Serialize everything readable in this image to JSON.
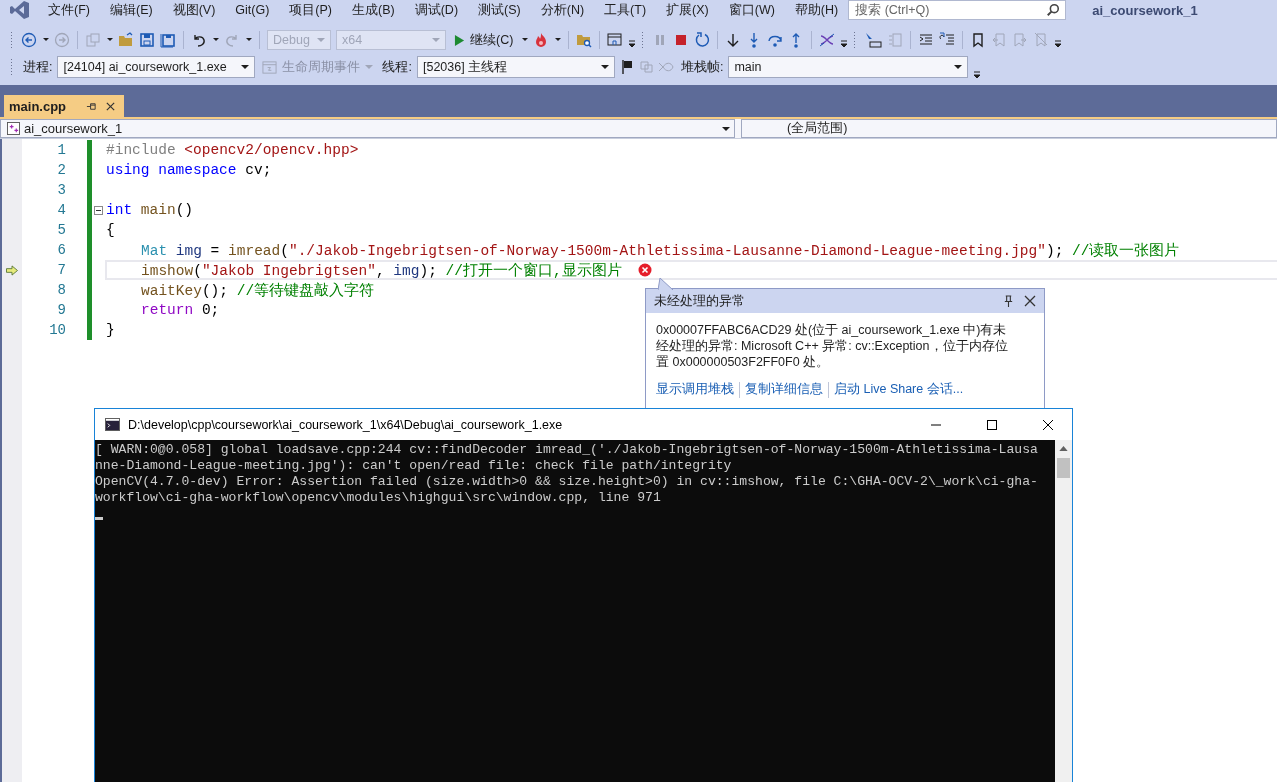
{
  "menu": {
    "items": [
      "文件(F)",
      "编辑(E)",
      "视图(V)",
      "Git(G)",
      "项目(P)",
      "生成(B)",
      "调试(D)",
      "测试(S)",
      "分析(N)",
      "工具(T)",
      "扩展(X)",
      "窗口(W)",
      "帮助(H)"
    ],
    "search": {
      "placeholder": "搜索 (Ctrl+Q)"
    },
    "title": "ai_coursework_1"
  },
  "toolbar": {
    "configuration": {
      "value": "Debug",
      "disabled": true
    },
    "platform": {
      "value": "x64",
      "disabled": true
    },
    "continue_button": {
      "label": "继续(C)"
    }
  },
  "debug_location": {
    "process": {
      "label": "进程:",
      "value": "[24104] ai_coursework_1.exe"
    },
    "lifecycle_events": {
      "label": "生命周期事件",
      "disabled": true
    },
    "thread": {
      "label": "线程:",
      "value": "[52036] 主线程"
    },
    "stack_frame": {
      "label": "堆栈帧:",
      "value": "main"
    }
  },
  "tabs": [
    {
      "label": "main.cpp",
      "selected": true
    }
  ],
  "navigation": {
    "project": "ai_coursework_1",
    "scope": "(全局范围)"
  },
  "editor": {
    "lines": [
      {
        "number": "1",
        "current": false,
        "foldable": false,
        "error": false,
        "tokens": [
          {
            "kind": "preproc",
            "text": "#include "
          },
          {
            "kind": "string",
            "text": "<opencv2/opencv.hpp>"
          }
        ]
      },
      {
        "number": "2",
        "current": false,
        "foldable": false,
        "error": false,
        "tokens": [
          {
            "kind": "keyword",
            "text": "using namespace "
          },
          {
            "kind": "plain",
            "text": "cv;"
          }
        ]
      },
      {
        "number": "3",
        "current": false,
        "foldable": false,
        "error": false
      },
      {
        "number": "4",
        "current": false,
        "foldable": true,
        "error": false,
        "tokens": [
          {
            "kind": "keyword",
            "text": "int "
          },
          {
            "kind": "function",
            "text": "main"
          },
          {
            "kind": "plain",
            "text": "()"
          }
        ]
      },
      {
        "number": "5",
        "current": false,
        "foldable": false,
        "error": false,
        "tokens": [
          {
            "kind": "plain",
            "text": "{"
          }
        ],
        "children": [
          {
            "number": "6",
            "current": false,
            "foldable": false,
            "error": false,
            "tokens": [
              {
                "kind": "type",
                "text": "Mat"
              },
              {
                "kind": "variable",
                "text": " img"
              },
              {
                "kind": "plain",
                "text": " = "
              },
              {
                "kind": "function",
                "text": "imread"
              },
              {
                "kind": "plain",
                "text": "("
              },
              {
                "kind": "string",
                "text": "\"./Jakob-Ingebrigtsen-of-Norway-1500m-Athletissima-Lausanne-Diamond-League-meeting.jpg\""
              },
              {
                "kind": "plain",
                "text": "); "
              },
              {
                "kind": "comment",
                "text": "//读取一张图片"
              }
            ]
          },
          {
            "number": "7",
            "current": true,
            "foldable": false,
            "error": true,
            "tokens": [
              {
                "kind": "function",
                "text": "imshow"
              },
              {
                "kind": "plain",
                "text": "("
              },
              {
                "kind": "string",
                "text": "\"Jakob Ingebrigtsen\""
              },
              {
                "kind": "plain",
                "text": ", "
              },
              {
                "kind": "variable",
                "text": "img"
              },
              {
                "kind": "plain",
                "text": "); "
              },
              {
                "kind": "comment",
                "text": "//打开一个窗口,显示图片"
              }
            ]
          },
          {
            "number": "8",
            "current": false,
            "foldable": false,
            "error": false,
            "tokens": [
              {
                "kind": "function",
                "text": "waitKey"
              },
              {
                "kind": "plain",
                "text": "(); "
              },
              {
                "kind": "comment",
                "text": "//等待键盘敲入字符"
              }
            ]
          },
          {
            "number": "9",
            "current": false,
            "foldable": false,
            "error": false,
            "tokens": [
              {
                "kind": "control",
                "text": "return"
              },
              {
                "kind": "plain",
                "text": " 0;"
              }
            ]
          }
        ]
      },
      {
        "number": "10",
        "current": false,
        "foldable": false,
        "error": false,
        "tokens": [
          {
            "kind": "plain",
            "text": "}"
          }
        ]
      }
    ]
  },
  "exception_popup": {
    "title": "未经处理的异常",
    "message": "0x00007FFABC6ACD29 处(位于 ai_coursework_1.exe 中)有未经处理的异常: Microsoft C++ 异常: cv::Exception，位于内存位置 0x000000503F2FF0F0 处。",
    "links": [
      "显示调用堆栈",
      "复制详细信息",
      "启动 Live Share 会话..."
    ]
  },
  "console": {
    "title": "D:\\develop\\cpp\\coursework\\ai_coursework_1\\x64\\Debug\\ai_coursework_1.exe",
    "lines": [
      "[ WARN:0@0.058] global loadsave.cpp:244 cv::findDecoder imread_('./Jakob-Ingebrigtsen-of-Norway-1500m-Athletissima-Lausa",
      "nne-Diamond-League-meeting.jpg'): can't open/read file: check file path/integrity",
      "OpenCV(4.7.0-dev) Error: Assertion failed (size.width>0 && size.height>0) in cv::imshow, file C:\\GHA-OCV-2\\_work\\ci-gha-",
      "workflow\\ci-gha-workflow\\opencv\\modules\\highgui\\src\\window.cpp, line 971"
    ]
  }
}
